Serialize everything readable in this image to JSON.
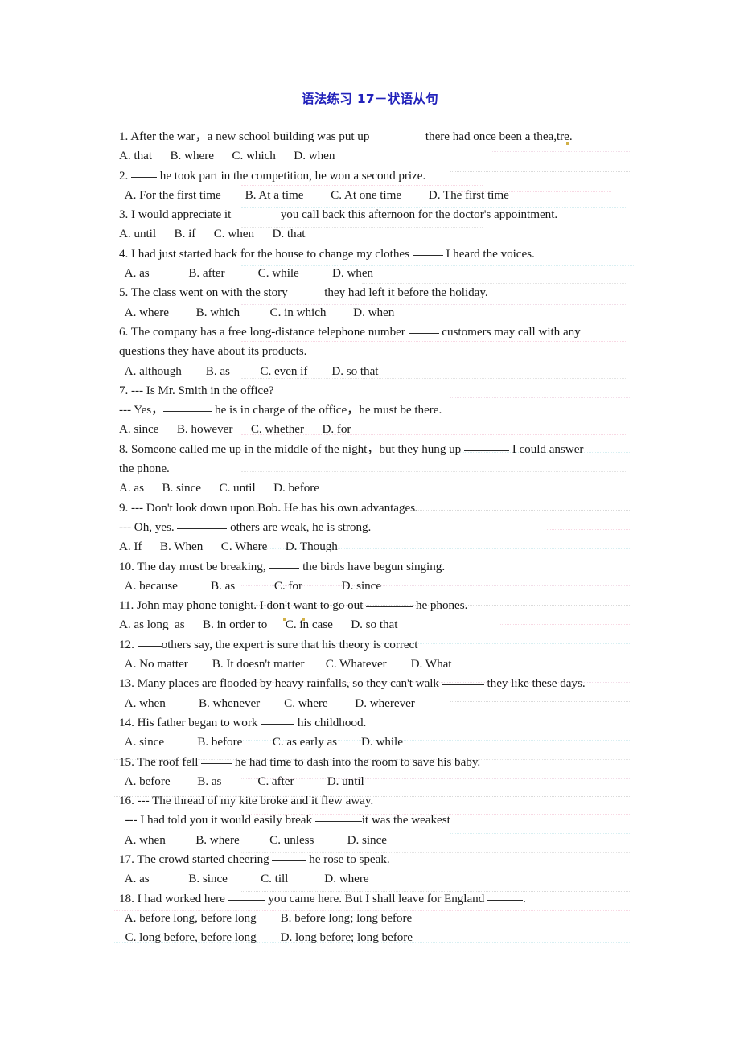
{
  "document": {
    "title": "语法练习 17－状语从句",
    "title_color": "#2222bb",
    "page_background": "#ffffff",
    "text_color": "#1a1a1a"
  },
  "questions": [
    {
      "number": "1",
      "stem_before": "1. After the war，a new school building was put up ",
      "blank_width": 62,
      "stem_after": " there had once been a thea,tre.",
      "options_line": "A. that      B. where      C. which      D. when",
      "options": [
        "A. that",
        "B. where",
        "C. which",
        "D. when"
      ]
    },
    {
      "number": "2",
      "stem_before": "2. ",
      "blank_width": 32,
      "stem_after": " he took part in the competition, he won a second prize.",
      "options_line": "  A. For the first time        B. At a time         C. At one time         D. The first time",
      "options": [
        "A. For the first time",
        "B. At a time",
        "C. At one time",
        "D. The first time"
      ]
    },
    {
      "number": "3",
      "stem_before": "3. I would appreciate it ",
      "blank_width": 54,
      "stem_after": " you call back this afternoon for the doctor's appointment.",
      "options_line": "A. until      B. if      C. when      D. that",
      "options": [
        "A. until",
        "B. if",
        "C. when",
        "D. that"
      ]
    },
    {
      "number": "4",
      "stem_before": "4. I had just started back for the house to change my clothes ",
      "blank_width": 38,
      "stem_after": " I heard the voices.",
      "options_line": "  A. as             B. after           C. while           D. when",
      "options": [
        "A. as",
        "B. after",
        "C. while",
        "D. when"
      ]
    },
    {
      "number": "5",
      "stem_before": "5. The class went on with the story ",
      "blank_width": 38,
      "stem_after": " they had left it before the holiday.",
      "options_line": "  A. where         B. which          C. in which         D. when",
      "options": [
        "A. where",
        "B. which",
        "C. in which",
        "D. when"
      ]
    },
    {
      "number": "6",
      "stem_before": "6. The company has a free long-distance telephone number ",
      "blank_width": 38,
      "stem_after": " customers may call with any",
      "stem_continuation": "questions they have about its products.",
      "options_line": "  A. although        B. as          C. even if        D. so that",
      "options": [
        "A. although",
        "B. as",
        "C. even if",
        "D. so that"
      ]
    },
    {
      "number": "7",
      "stem_before": "7. --- Is Mr. Smith in the office?",
      "blank_width": 0,
      "stem_after": "",
      "dialog_line_before": "--- Yes，",
      "dialog_blank_width": 60,
      "dialog_line_after": " he is in charge of the office，he must be there.",
      "options_line": "A. since      B. however      C. whether      D. for",
      "options": [
        "A. since",
        "B. however",
        "C. whether",
        "D. for"
      ]
    },
    {
      "number": "8",
      "stem_before": "8. Someone called me up in the middle of the night，but they hung up ",
      "blank_width": 56,
      "stem_after": " I could answer",
      "stem_continuation": "the phone.",
      "options_line": "A. as      B. since      C. until      D. before",
      "options": [
        "A. as",
        "B. since",
        "C. until",
        "D. before"
      ]
    },
    {
      "number": "9",
      "stem_before": "9. --- Don't look down upon Bob. He has his own advantages.",
      "blank_width": 0,
      "stem_after": "",
      "dialog_line_before": "--- Oh, yes. ",
      "dialog_blank_width": 62,
      "dialog_line_after": " others are weak, he is strong.",
      "options_line": "A. If      B. When      C. Where      D. Though",
      "options": [
        "A. If",
        "B. When",
        "C. Where",
        "D. Though"
      ]
    },
    {
      "number": "10",
      "stem_before": "10. The day must be breaking, ",
      "blank_width": 38,
      "stem_after": " the birds have begun singing.",
      "options_line": "  A. because           B. as             C. for             D. since",
      "options": [
        "A. because",
        "B. as",
        "C. for",
        "D. since"
      ]
    },
    {
      "number": "11",
      "stem_before": "11. John may phone tonight. I don't want to go out ",
      "blank_width": 58,
      "stem_after": " he phones.",
      "options_line": "A. as long  as      B. in order to      C. in case      D. so that",
      "options": [
        "A. as long  as",
        "B. in order to",
        "C. in case",
        "D. so that"
      ]
    },
    {
      "number": "12",
      "stem_before": "12. ",
      "blank_width": 30,
      "stem_after": "others say, the expert is sure that his theory is correct",
      "options_line": "  A. No matter        B. It doesn't matter       C. Whatever        D. What",
      "options": [
        "A. No matter",
        "B. It doesn't matter",
        "C. Whatever",
        "D. What"
      ]
    },
    {
      "number": "13",
      "stem_before": "13. Many places are flooded by heavy rainfalls, so they can't walk ",
      "blank_width": 52,
      "stem_after": " they like these days.",
      "options_line": "  A. when           B. whenever        C. where         D. wherever",
      "options": [
        "A. when",
        "B. whenever",
        "C. where",
        "D. wherever"
      ]
    },
    {
      "number": "14",
      "stem_before": "14. His father began to work ",
      "blank_width": 42,
      "stem_after": " his childhood.",
      "options_line": "  A. since           B. before          C. as early as        D. while",
      "options": [
        "A. since",
        "B. before",
        "C. as early as",
        "D. while"
      ]
    },
    {
      "number": "15",
      "stem_before": "15. The roof fell ",
      "blank_width": 38,
      "stem_after": " he had time to dash into the room to save his baby.",
      "options_line": "  A. before         B. as            C. after           D. until",
      "options": [
        "A. before",
        "B. as",
        "C. after",
        "D. until"
      ]
    },
    {
      "number": "16",
      "stem_before": "16. --- The thread of my kite broke and it flew away.",
      "blank_width": 0,
      "stem_after": "",
      "dialog_line_before": "  --- I had told you it would easily break ",
      "dialog_blank_width": 58,
      "dialog_line_after": "it was the weakest",
      "options_line": "  A. when          B. where          C. unless           D. since",
      "options": [
        "A. when",
        "B. where",
        "C. unless",
        "D. since"
      ]
    },
    {
      "number": "17",
      "stem_before": "17. The crowd started cheering ",
      "blank_width": 42,
      "stem_after": " he rose to speak.",
      "options_line": "  A. as             B. since           C. till            D. where",
      "options": [
        "A. as",
        "B. since",
        "C. till",
        "D. where"
      ]
    },
    {
      "number": "18",
      "stem_before": "18. I had worked here ",
      "blank_width": 46,
      "stem_after": " you came here. But I shall leave for England ",
      "trailing_blank_width": 44,
      "stem_tail": ".",
      "options_line": "  A. before long, before long        B. before long; long before",
      "options_line2": "  C. long before, before long        D. long before; long before",
      "options": [
        "A. before long, before long",
        "B. before long; long before",
        "C. long before, before long",
        "D. long before; long before"
      ]
    }
  ]
}
